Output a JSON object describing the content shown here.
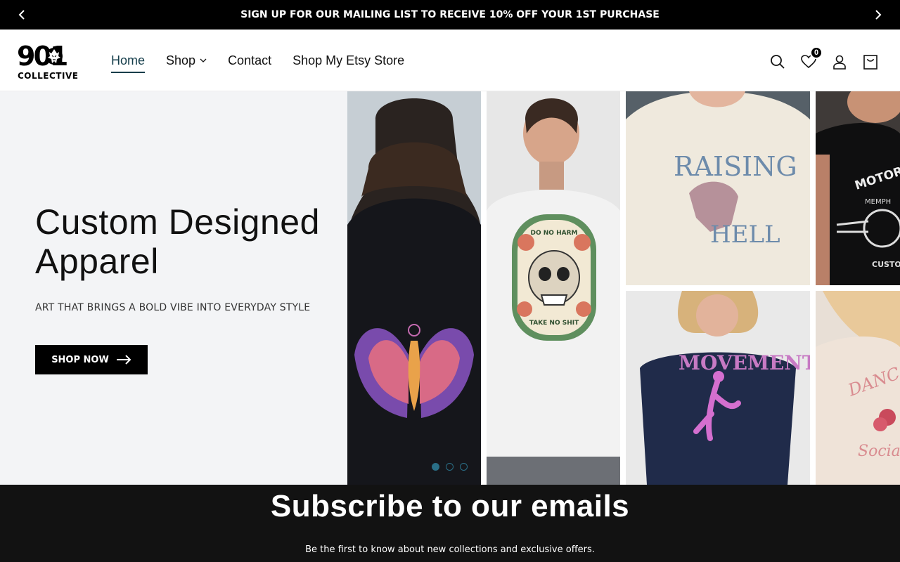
{
  "announcement": {
    "text": "SIGN UP FOR OUR MAILING LIST TO RECEIVE 10% OFF YOUR 1ST PURCHASE",
    "prev_icon": "chevron-left-icon",
    "next_icon": "chevron-right-icon"
  },
  "header": {
    "logo_top": "901",
    "logo_bottom": "COLLECTIVE",
    "nav": [
      {
        "label": "Home",
        "active": true
      },
      {
        "label": "Shop",
        "dropdown": true
      },
      {
        "label": "Contact"
      },
      {
        "label": "Shop My Etsy Store"
      }
    ],
    "icons": [
      "search-icon",
      "heart-icon",
      "account-icon",
      "cart-icon"
    ],
    "wishlist_count": "0"
  },
  "hero": {
    "title_line1": "Custom Designed",
    "title_line2": "Apparel",
    "subtitle": "ART THAT BRINGS A BOLD VIBE INTO EVERYDAY STYLE",
    "button_label": "SHOP NOW",
    "slides_total": 3,
    "slide_active": 1,
    "collage_texts": {
      "skull_top": "DO NO HARM",
      "skull_bottom": "TAKE NO SHIT",
      "raising": "RAISING",
      "hell": "HELL",
      "motor": "MOTORC",
      "memphis": "MEMPH",
      "custom": "CUSTOM",
      "movement": "MOVEMENT",
      "dance": "DANC",
      "social": "Socia"
    }
  },
  "subscribe": {
    "title": "Subscribe to our emails",
    "text": "Be the first to know about new collections and exclusive offers."
  },
  "colors": {
    "announcement_bg": "#000000",
    "accent": "#143d4a",
    "dot": "#2a6f87",
    "subscribe_bg": "#121212"
  }
}
